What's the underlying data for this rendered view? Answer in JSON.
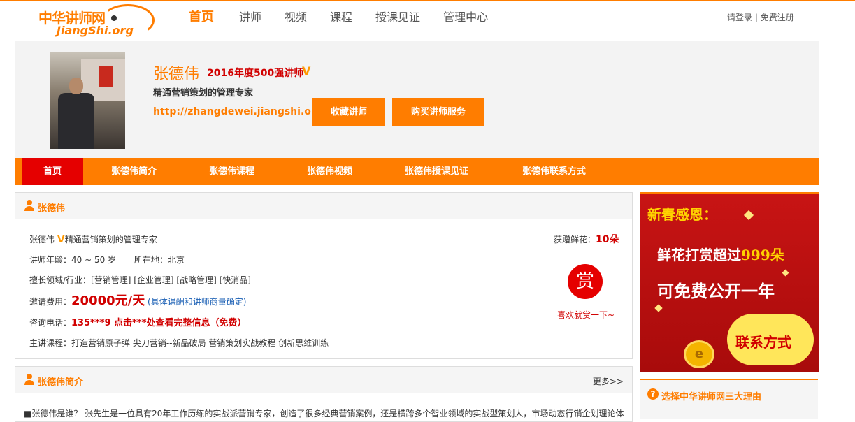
{
  "site": {
    "logo_cn": "中华讲师网",
    "logo_en": "JiangShi.org"
  },
  "nav": [
    {
      "label": "首页"
    },
    {
      "label": "讲师"
    },
    {
      "label": "视频"
    },
    {
      "label": "课程"
    },
    {
      "label": "授课见证"
    },
    {
      "label": "管理中心"
    }
  ],
  "auth": {
    "login": "请登录",
    "sep": "|",
    "register": "免费注册"
  },
  "profile": {
    "name": "张德伟",
    "rank": "2016年度500强讲师",
    "v_badge": "V",
    "motto": "精通营销策划的管理专家",
    "url": "http://zhangdewei.jiangshi.org",
    "btn_favorite": "收藏讲师",
    "btn_buy": "购买讲师服务"
  },
  "subnav": [
    {
      "label": "首页"
    },
    {
      "label": "张德伟简介"
    },
    {
      "label": "张德伟课程"
    },
    {
      "label": "张德伟视频"
    },
    {
      "label": "张德伟授课见证"
    },
    {
      "label": "张德伟联系方式"
    }
  ],
  "info_card": {
    "title": "张德伟",
    "line1_name": "张德伟",
    "line1_v": "V",
    "line1_motto": "精通营销策划的管理专家",
    "age": "讲师年龄：40 ~ 50 岁",
    "location": "所在地：北京",
    "fields": "擅长领域/行业：[营销管理] [企业管理] [战略管理] [快消品]",
    "fee_label": "邀请费用：",
    "fee_value": "20000元/天",
    "fee_note": "(具体课酬和讲师商量确定)",
    "phone_label": "咨询电话：",
    "phone_value": "135***9 点击***处查看完整信息（免费）",
    "courses": "主讲课程：打造营销原子弹 尖刀营销--新品破局 营销策划实战教程 创新思维训练",
    "flower_label": "获赠鲜花：",
    "flower_count": "10朵",
    "reward": "赏",
    "like": "喜欢就赏一下~"
  },
  "intro_card": {
    "title": "张德伟简介",
    "more": "更多>>",
    "text": "■张德伟是谁？ 张先生是一位具有20年工作历练的实战派营销专家，创造了很多经典营销案例，还是横跨多个智业领域的实战型策划人，市场动态行销企划理论体"
  },
  "banner": {
    "line1": "新春感恩：",
    "line2_pre": "鲜花打赏超过",
    "line2_num": "999朵",
    "line3": "可免费公开一年",
    "line4": "联系方式",
    "coin": "e"
  },
  "reason": {
    "title": "选择中华讲师网三大理由",
    "icon": "?"
  },
  "colors": {
    "accent": "#ff7d00",
    "red": "#e50000",
    "link": "#1a5fb4"
  }
}
